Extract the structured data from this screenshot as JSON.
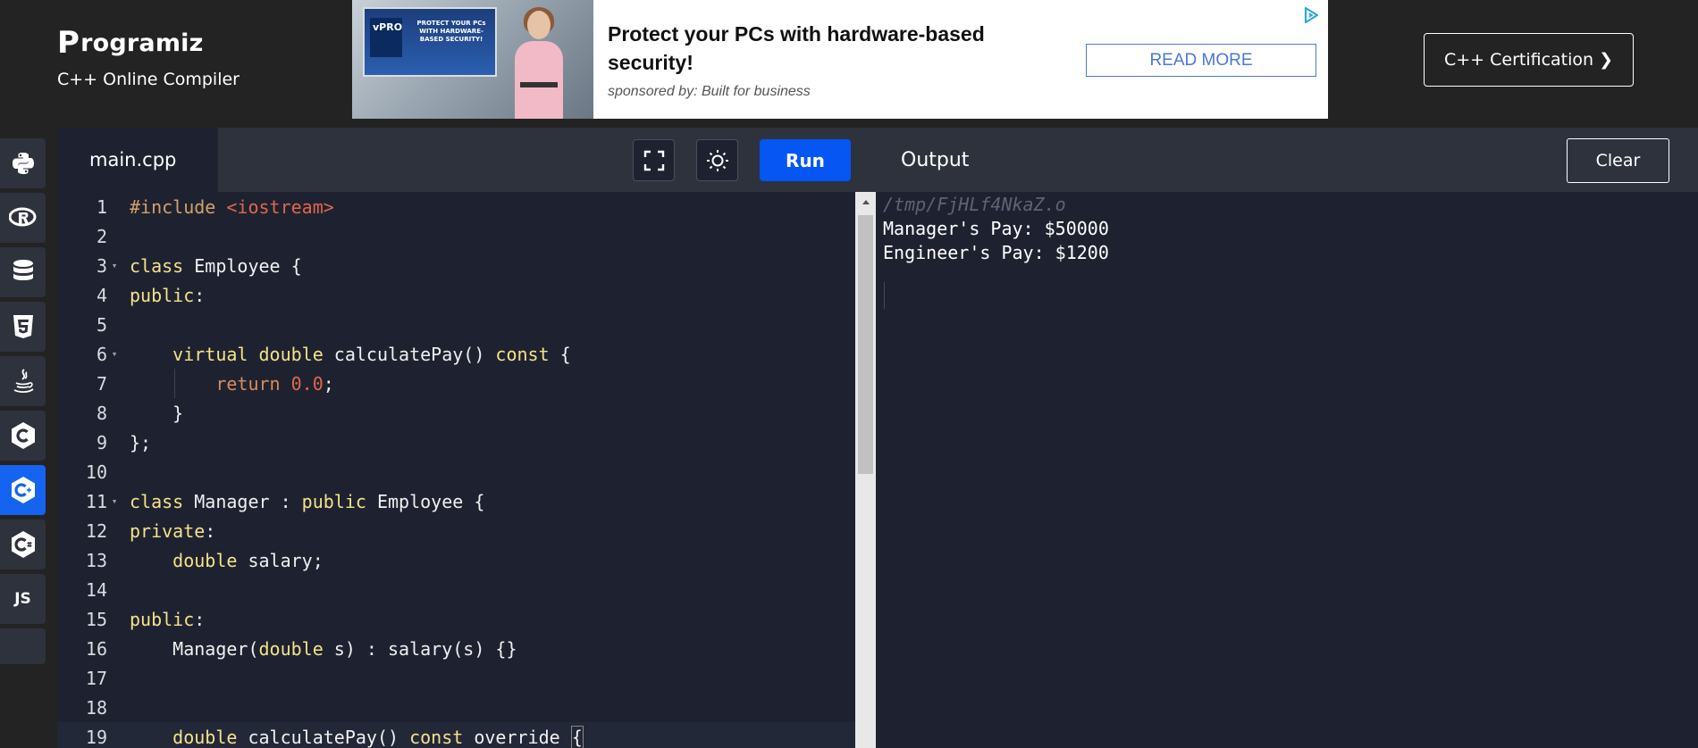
{
  "header": {
    "brand_mark": "P",
    "brand_rest": "rogramiz",
    "subtitle": "C++ Online Compiler",
    "certification_button": "C++ Certification ❯"
  },
  "ad": {
    "title": "Protect your PCs with hardware-based security!",
    "sponsor": "sponsored by: Built for business",
    "button": "READ MORE",
    "thumb_badge": "vPRO",
    "thumb_text": "PROTECT YOUR PCs WITH HARDWARE-BASED SECURITY!"
  },
  "sidebar": {
    "languages": [
      "python",
      "r",
      "sql",
      "html5",
      "java",
      "c",
      "cpp",
      "csharp",
      "js"
    ],
    "active": "cpp",
    "js_label": "JS"
  },
  "editor": {
    "file_tab": "main.cpp",
    "run_label": "Run",
    "lines": [
      {
        "n": "1"
      },
      {
        "n": "2"
      },
      {
        "n": "3"
      },
      {
        "n": "4"
      },
      {
        "n": "5"
      },
      {
        "n": "6"
      },
      {
        "n": "7"
      },
      {
        "n": "8"
      },
      {
        "n": "9"
      },
      {
        "n": "10"
      },
      {
        "n": "11"
      },
      {
        "n": "12"
      },
      {
        "n": "13"
      },
      {
        "n": "14"
      },
      {
        "n": "15"
      },
      {
        "n": "16"
      },
      {
        "n": "17"
      },
      {
        "n": "18"
      },
      {
        "n": "19"
      }
    ]
  },
  "output": {
    "title": "Output",
    "clear_label": "Clear",
    "lines": [
      "/tmp/FjHLf4NkaZ.o",
      "Manager's Pay: $50000",
      "Engineer's Pay: $1200"
    ]
  }
}
